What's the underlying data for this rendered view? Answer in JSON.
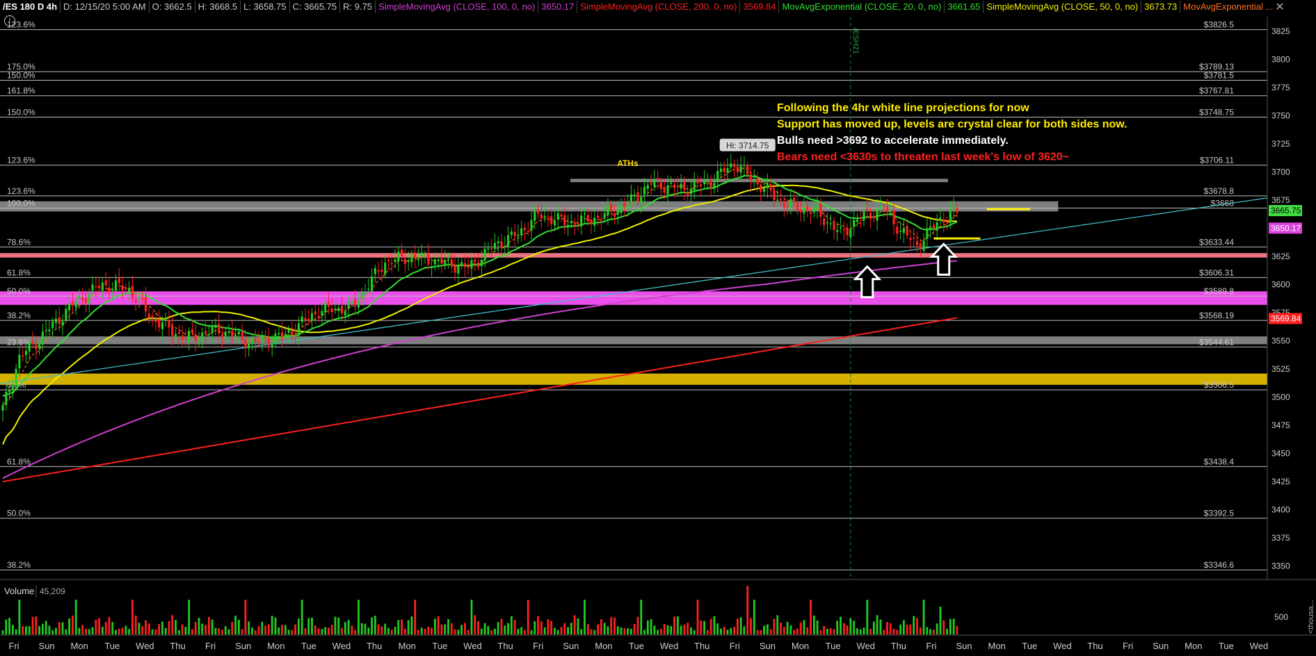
{
  "header": {
    "symbol": "/ES 180 D 4h",
    "date": "D: 12/15/20 5:00 AM",
    "open": "O: 3662.5",
    "high": "H: 3668.5",
    "low": "L: 3658.75",
    "close": "C: 3665.75",
    "range": "R: 9.75",
    "studies": [
      {
        "label": "SimpleMovingAvg (CLOSE, 100, 0, no)",
        "value": "3650.17",
        "color": "#d040d0"
      },
      {
        "label": "SimpleMovingAvg (CLOSE, 200, 0, no)",
        "value": "3569.84",
        "color": "#ff2020"
      },
      {
        "label": "MovAvgExponential (CLOSE, 20, 0, no)",
        "value": "3661.65",
        "color": "#30e030"
      },
      {
        "label": "SimpleMovingAvg (CLOSE, 50, 0, no)",
        "value": "3673.73",
        "color": "#f0f000"
      },
      {
        "label": "MovAvgExponential ...",
        "value": "",
        "color": "#ff7020"
      }
    ]
  },
  "close_icon": "close-icon",
  "study_icon": "info-icon",
  "chart_data": {
    "type": "candlestick",
    "symbol": "/ES",
    "timeframe": "4h",
    "ylim": [
      3338,
      3838
    ],
    "y_ticks": [
      3350,
      3375,
      3400,
      3425,
      3450,
      3475,
      3500,
      3525,
      3550,
      3575,
      3600,
      3625,
      3650,
      3675,
      3700,
      3725,
      3750,
      3775,
      3800,
      3825
    ],
    "x_day_labels": [
      "Fri",
      "Sun",
      "Mon",
      "Tue",
      "Wed",
      "Thu",
      "Fri",
      "Sun",
      "Mon",
      "Tue",
      "Wed",
      "Thu",
      "Mon",
      "Tue",
      "Wed",
      "Thu",
      "Fri",
      "Sun",
      "Mon",
      "Tue",
      "Wed",
      "Thu",
      "Fri",
      "Sun",
      "Mon",
      "Tue",
      "Wed",
      "Thu",
      "Fri",
      "Sun",
      "Mon",
      "Tue",
      "Wed",
      "Thu",
      "Fri",
      "Sun",
      "Mon",
      "Tue",
      "Wed"
    ],
    "levels": [
      {
        "label": "123.6%",
        "price": "$3826.5",
        "y": 3826.5
      },
      {
        "label": "175.0%",
        "price": "$3789.13",
        "y": 3789.13
      },
      {
        "label": "150.0%",
        "price": "$3781.5",
        "y": 3781.5
      },
      {
        "label": "161.8%",
        "price": "$3767.81",
        "y": 3767.81
      },
      {
        "label": "150.0%",
        "price": "$3748.75",
        "y": 3748.75
      },
      {
        "label": "123.6%",
        "price": "$3706.11",
        "y": 3706.11
      },
      {
        "label": "123.6%",
        "price": "$3678.8",
        "y": 3678.8
      },
      {
        "label": "100.0%",
        "price": "$3668",
        "y": 3668
      },
      {
        "label": "78.6%",
        "price": "$3633.44",
        "y": 3633.44
      },
      {
        "label": "61.8%",
        "price": "$3606.31",
        "y": 3606.31
      },
      {
        "label": "50.0%",
        "price": "$3589.8",
        "y": 3589.8
      },
      {
        "label": "38.2%",
        "price": "$3568.19",
        "y": 3568.19
      },
      {
        "label": "23.6%",
        "price": "$3544.61",
        "y": 3544.61
      },
      {
        "label": "0.0%",
        "price": "$3506.5",
        "y": 3506.5
      },
      {
        "label": "61.8%",
        "price": "$3438.4",
        "y": 3438.4
      },
      {
        "label": "50.0%",
        "price": "$3392.5",
        "y": 3392.5
      },
      {
        "label": "38.2%",
        "price": "$3346.6",
        "y": 3346.6
      }
    ],
    "zones": [
      {
        "from": 3511,
        "to": 3521,
        "color": "#e6c000",
        "x_start": 0,
        "x_end": 1.0
      },
      {
        "from": 3547,
        "to": 3554,
        "color": "#8a8a8a",
        "x_start": 0,
        "x_end": 1.0
      },
      {
        "from": 3582,
        "to": 3594,
        "color": "#ff55ff",
        "x_start": 0,
        "x_end": 1.0
      },
      {
        "from": 3624,
        "to": 3628,
        "color": "#ff7c8c",
        "x_start": 0,
        "x_end": 1.0
      },
      {
        "from": 3665,
        "to": 3674,
        "color": "#8a8a8a",
        "x_start": 0,
        "x_end": 0.835
      },
      {
        "from": 3691,
        "to": 3694,
        "color": "#8a8a8a",
        "x_start": 0.45,
        "x_end": 0.748
      }
    ],
    "close_pts": [
      [
        0,
        3490
      ],
      [
        5,
        3535
      ],
      [
        12,
        3555
      ],
      [
        22,
        3585
      ],
      [
        30,
        3600
      ],
      [
        38,
        3596
      ],
      [
        45,
        3570
      ],
      [
        55,
        3552
      ],
      [
        65,
        3560
      ],
      [
        75,
        3548
      ],
      [
        85,
        3555
      ],
      [
        95,
        3577
      ],
      [
        105,
        3580
      ],
      [
        115,
        3620
      ],
      [
        123,
        3625
      ],
      [
        132,
        3620
      ],
      [
        140,
        3615
      ],
      [
        148,
        3635
      ],
      [
        155,
        3645
      ],
      [
        161,
        3662
      ],
      [
        170,
        3655
      ],
      [
        180,
        3660
      ],
      [
        188,
        3672
      ],
      [
        195,
        3690
      ],
      [
        205,
        3685
      ],
      [
        213,
        3692
      ],
      [
        220,
        3708
      ],
      [
        227,
        3690
      ],
      [
        235,
        3672
      ],
      [
        245,
        3664
      ],
      [
        252,
        3645
      ],
      [
        258,
        3660
      ],
      [
        265,
        3668
      ],
      [
        270,
        3648
      ],
      [
        275,
        3635
      ],
      [
        282,
        3658
      ],
      [
        287,
        3665
      ]
    ],
    "hi_label": "Hi: 3714.75",
    "hi_bar": 224,
    "hi_price": 3714.75,
    "ath_label": "ATHs",
    "ath_bar": 190,
    "ath_price": 3698,
    "expiry_bar": 255,
    "expiry_label": "/ESH21",
    "current_price": {
      "label": "3665.75",
      "y": 3665.75,
      "color": "#44dd44"
    },
    "sma100_tag": {
      "label": "3650.17",
      "y": 3650.17,
      "color": "#dd44dd"
    },
    "sma200_tag": {
      "label": "3569.84",
      "y": 3569.84,
      "color": "#ff2020"
    },
    "trendline": {
      "from": [
        0,
        3512
      ],
      "to": [
        1.0,
        3677
      ]
    },
    "future_levels": [
      {
        "y": 3667,
        "color": "#ffee00",
        "from_bar": 296,
        "to_bar": 309
      },
      {
        "y": 3641,
        "color": "#ffee00",
        "from_bar": 280,
        "to_bar": 294
      }
    ],
    "arrows": [
      {
        "bar": 260,
        "price": 3616
      },
      {
        "bar": 283,
        "price": 3636
      }
    ],
    "annotations": [
      {
        "text": "Following the 4hr white line projections for now",
        "color": "#ffee00"
      },
      {
        "text": "Support has moved up, levels are crystal clear for both sides now.",
        "color": "#ffee00"
      },
      {
        "text": "Bulls need >3692 to accelerate immediately.",
        "color": "#ffffff"
      },
      {
        "text": "Bears need <3630s to threaten last week's low of 3620~",
        "color": "#ff2020"
      }
    ],
    "volume": {
      "label": "Volume",
      "value": "45,209",
      "tick": "500",
      "unit": "<thousa..."
    }
  }
}
